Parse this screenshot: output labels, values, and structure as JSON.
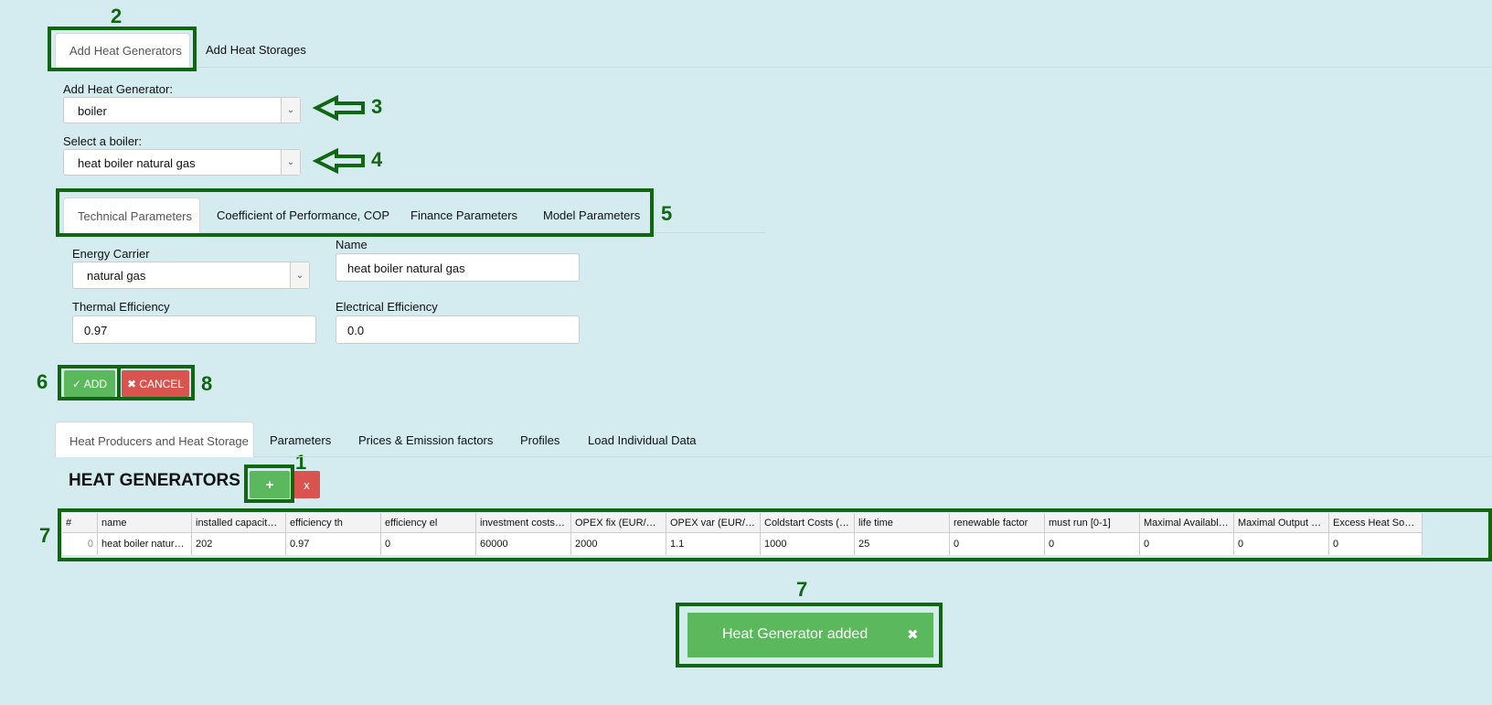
{
  "annotations": {
    "n1": "1",
    "n2": "2",
    "n3": "3",
    "n4": "4",
    "n5": "5",
    "n6": "6",
    "n7a": "7",
    "n7b": "7",
    "n8": "8"
  },
  "top_tabs": [
    "Add Heat Generators",
    "Add Heat Storages"
  ],
  "form": {
    "add_generator_label": "Add Heat Generator:",
    "add_generator_value": "boiler",
    "select_boiler_label": "Select a boiler:",
    "select_boiler_value": "heat boiler natural gas"
  },
  "param_tabs": [
    "Technical Parameters",
    "Coefficient of Performance, COP",
    "Finance Parameters",
    "Model Parameters"
  ],
  "technical": {
    "energy_carrier_label": "Energy Carrier",
    "energy_carrier_value": "natural gas",
    "name_label": "Name",
    "name_value": "heat boiler natural gas",
    "thermal_label": "Thermal Efficiency",
    "thermal_value": "0.97",
    "electrical_label": "Electrical Efficiency",
    "electrical_value": "0.0"
  },
  "actions": {
    "add": "✓ ADD",
    "cancel": "✖ CANCEL"
  },
  "bottom_tabs": [
    "Heat Producers and Heat Storage",
    "Parameters",
    "Prices & Emission factors",
    "Profiles",
    "Load Individual Data"
  ],
  "section": {
    "title": "HEAT GENERATORS",
    "add": "+",
    "remove": "x"
  },
  "table": {
    "headers": [
      "#",
      "name",
      "installed capacity (MW)",
      "efficiency th",
      "efficiency el",
      "investment costs (EUR)",
      "OPEX fix (EUR/MWa)",
      "OPEX var (EUR/MWh)",
      "Coldstart Costs (EUR)",
      "life time",
      "renewable factor",
      "must run [0-1]",
      "Maximal Available Pot",
      "Maximal Output Power",
      "Excess Heat Source"
    ],
    "rows": [
      [
        "0",
        "heat boiler natural gas",
        "202",
        "0.97",
        "0",
        "60000",
        "2000",
        "1.1",
        "1000",
        "25",
        "0",
        "0",
        "0",
        "0",
        "0"
      ]
    ]
  },
  "toast": {
    "message": "Heat Generator added",
    "close": "✖"
  },
  "colors": {
    "background": "#d4ebef",
    "annotation_green": "#116611",
    "success": "#5cb85c",
    "danger": "#d9534f"
  }
}
